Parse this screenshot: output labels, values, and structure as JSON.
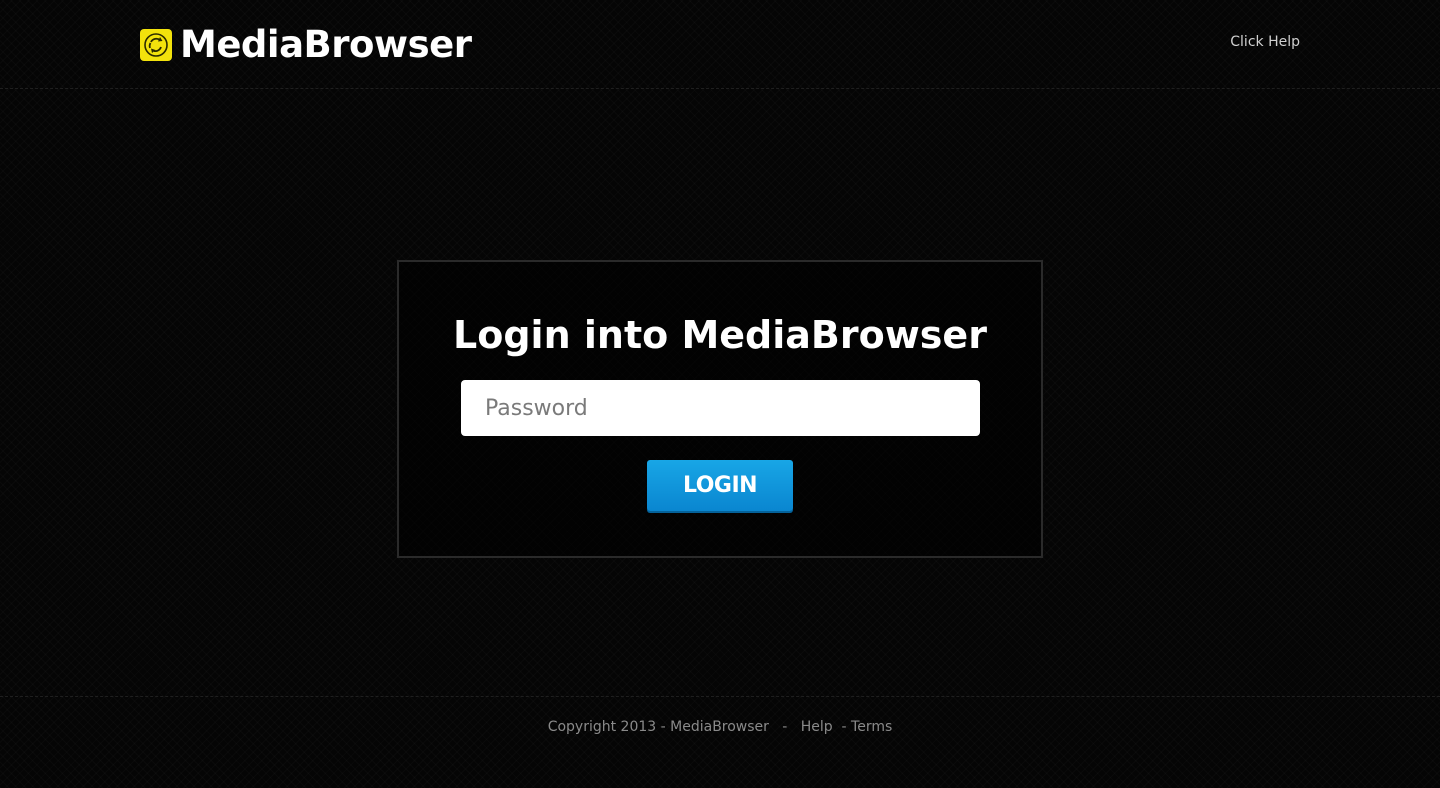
{
  "header": {
    "brand_name": "MediaBrowser",
    "logo_icon": "recycle-arrows-icon",
    "help_link": "Click Help"
  },
  "login": {
    "title": "Login into MediaBrowser",
    "password_placeholder": "Password",
    "password_value": "",
    "button_label": "LOGIN"
  },
  "footer": {
    "copyright": "Copyright 2013 - MediaBrowser",
    "separator_1": "-",
    "help_link": "Help",
    "separator_2": "-",
    "terms_link": "Terms"
  },
  "colors": {
    "background": "#050505",
    "logo_yellow": "#f2e20c",
    "button_blue": "#0a86d0",
    "footer_text": "#8a8a8a"
  }
}
